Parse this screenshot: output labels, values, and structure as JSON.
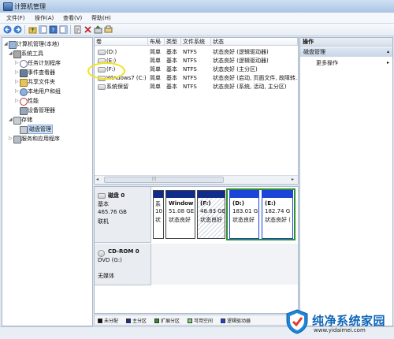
{
  "window": {
    "title": "计算机管理"
  },
  "menu": [
    "文件(F)",
    "操作(A)",
    "查看(V)",
    "帮助(H)"
  ],
  "tree": [
    {
      "label": "计算机管理(本地)",
      "icon": "computer-icon",
      "expanded": true
    },
    {
      "label": "系统工具",
      "icon": "tools-icon",
      "expanded": true
    },
    {
      "label": "任务计划程序",
      "icon": "clock-icon"
    },
    {
      "label": "事件查看器",
      "icon": "event-log-icon"
    },
    {
      "label": "共享文件夹",
      "icon": "folder-icon"
    },
    {
      "label": "本地用户和组",
      "icon": "users-icon"
    },
    {
      "label": "性能",
      "icon": "performance-icon"
    },
    {
      "label": "设备管理器",
      "icon": "device-manager-icon"
    },
    {
      "label": "存储",
      "icon": "storage-icon",
      "expanded": true
    },
    {
      "label": "磁盘管理",
      "icon": "disk-management-icon",
      "selected": true
    },
    {
      "label": "服务和应用程序",
      "icon": "services-icon"
    }
  ],
  "volume_table": {
    "columns": [
      "卷",
      "布局",
      "类型",
      "文件系统",
      "状态"
    ],
    "rows": [
      [
        "(D:)",
        "简单",
        "基本",
        "NTFS",
        "状态良好 (逻辑驱动器)"
      ],
      [
        "(E:)",
        "简单",
        "基本",
        "NTFS",
        "状态良好 (逻辑驱动器)"
      ],
      [
        "(F:)",
        "简单",
        "基本",
        "NTFS",
        "状态良好 (主分区)"
      ],
      [
        "Windows7 (C:)",
        "简单",
        "基本",
        "NTFS",
        "状态良好 (启动, 页面文件, 故障转..."
      ],
      [
        "系统保留",
        "简单",
        "基本",
        "NTFS",
        "状态良好 (系统, 活动, 主分区)"
      ]
    ]
  },
  "disks": [
    {
      "name": "磁盘 0",
      "kind": "基本",
      "size": "465.76 GB",
      "state": "联机",
      "partitions": [
        {
          "lines": [
            "系",
            "10",
            "状"
          ]
        },
        {
          "lines": [
            "Window",
            "51.08 GE",
            "状态良好"
          ]
        },
        {
          "lines": [
            "(F:)",
            "48.83 GE",
            "状态良好"
          ]
        },
        {
          "lines": [
            "(D:)",
            "183.01 G",
            "状态良好"
          ]
        },
        {
          "lines": [
            "(E:)",
            "182.74 G",
            "状态良好 ("
          ]
        }
      ]
    },
    {
      "name": "CD-ROM 0",
      "kind": "DVD (G:)",
      "state": "无媒体"
    }
  ],
  "legend": [
    {
      "label": "未分配",
      "color": "#111111"
    },
    {
      "label": "主分区",
      "color": "#1c2f8f"
    },
    {
      "label": "扩展分区",
      "color": "#2f8f2f"
    },
    {
      "label": "可用空间",
      "color": "#7fd37f"
    },
    {
      "label": "逻辑驱动器",
      "color": "#1c44d8"
    }
  ],
  "actions": {
    "header": "操作",
    "section": "磁盘管理",
    "items": [
      "更多操作"
    ]
  },
  "watermark": {
    "title": "纯净系统家园",
    "url": "www.yidaimei.com"
  }
}
